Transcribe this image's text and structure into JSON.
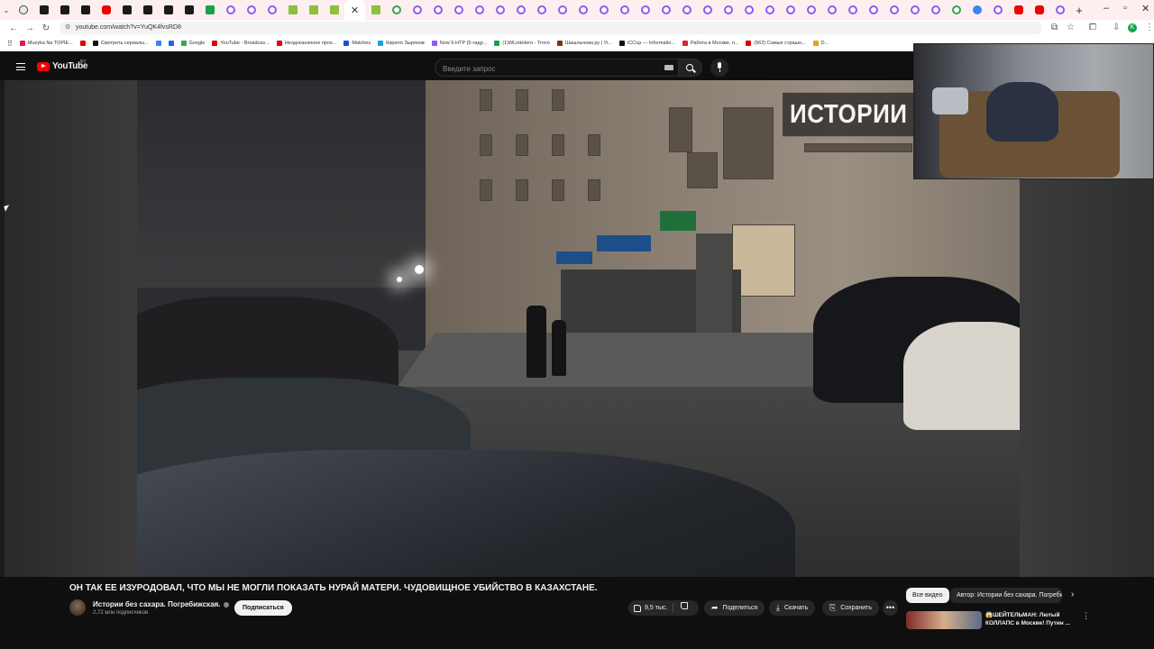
{
  "browser": {
    "tabs": [
      "chevron",
      "chrome",
      "s",
      "s",
      "s",
      "yt",
      "s",
      "s",
      "s",
      "s",
      "k",
      "tw",
      "tw",
      "tw",
      "folder",
      "folder",
      "folder",
      "close",
      "folder",
      "g",
      "tw",
      "tw",
      "tw",
      "tw",
      "tw",
      "tw",
      "tw",
      "tw",
      "tw",
      "tw",
      "tw",
      "tw",
      "tw",
      "tw",
      "tw",
      "tw",
      "tw",
      "tw",
      "tw",
      "tw",
      "tw",
      "tw",
      "tw",
      "tw",
      "tw",
      "tw",
      "g",
      "bl",
      "tw",
      "yt",
      "yt",
      "tw"
    ],
    "new_tab": "+",
    "url": "youtube.com/watch?v=YuQK4fvsRD8",
    "bookmarks": [
      {
        "label": "Muzyka Na TOPIE...",
        "color": "#e11d48"
      },
      {
        "label": "",
        "color": "#e00000"
      },
      {
        "label": "Смотреть сериалы...",
        "color": "#111111"
      },
      {
        "label": "",
        "color": "#3b82f6"
      },
      {
        "label": "",
        "color": "#2563eb"
      },
      {
        "label": "Google",
        "color": "#34a853"
      },
      {
        "label": "YouTube - Broadcas...",
        "color": "#e00000"
      },
      {
        "label": "Неоднозначное прох...",
        "color": "#e00000"
      },
      {
        "label": "Matches",
        "color": "#1d4ed8"
      },
      {
        "label": "Кирилл Зырянов",
        "color": "#0ea5e9"
      },
      {
        "label": "Now 5-HTP (5-гидр...",
        "color": "#8b5cf6"
      },
      {
        "label": "(1)WLinkHero - Trovo",
        "color": "#16a34a"
      },
      {
        "label": "Шашлычник.ру | Уi...",
        "color": "#78350f"
      },
      {
        "label": "iCCup — Informatio...",
        "color": "#111111"
      },
      {
        "label": "Работа в Москве, п...",
        "color": "#dc2626"
      },
      {
        "label": "(562) Самые страшн...",
        "color": "#e00000"
      },
      {
        "label": "D...",
        "color": "#f59e0b"
      }
    ]
  },
  "youtube": {
    "logo_text": "YouTube",
    "region": "BY",
    "search_placeholder": "Введите запрос"
  },
  "video": {
    "overlay_text": "ИСТОРИИ БЕЗ",
    "title": "ОН ТАК ЕЕ ИЗУРОДОВАЛ, ЧТО МЫ НЕ МОГЛИ ПОКАЗАТЬ НУРАЙ МАТЕРИ. ЧУДОВИЩНОЕ УБИЙСТВО В КАЗАХСТАНЕ.",
    "channel_name": "Истории без сахара. Погребижская.",
    "subscribers": "2,72 млн подписчиков",
    "subscribe_label": "Подписаться",
    "likes": "9,5 тыс.",
    "share_label": "Поделиться",
    "download_label": "Скачать",
    "save_label": "Сохранить",
    "more_label": "•••"
  },
  "sidebar": {
    "chip_all": "Все видео",
    "chip_author": "Автор: Истории без сахара. Погребижская.",
    "next_arrow": "›",
    "rec_title": "😱ШЕЙТЕЛЬМАН: Лютый КОЛЛАПС в Москве! Путин ...",
    "rec_more": "⋮"
  }
}
